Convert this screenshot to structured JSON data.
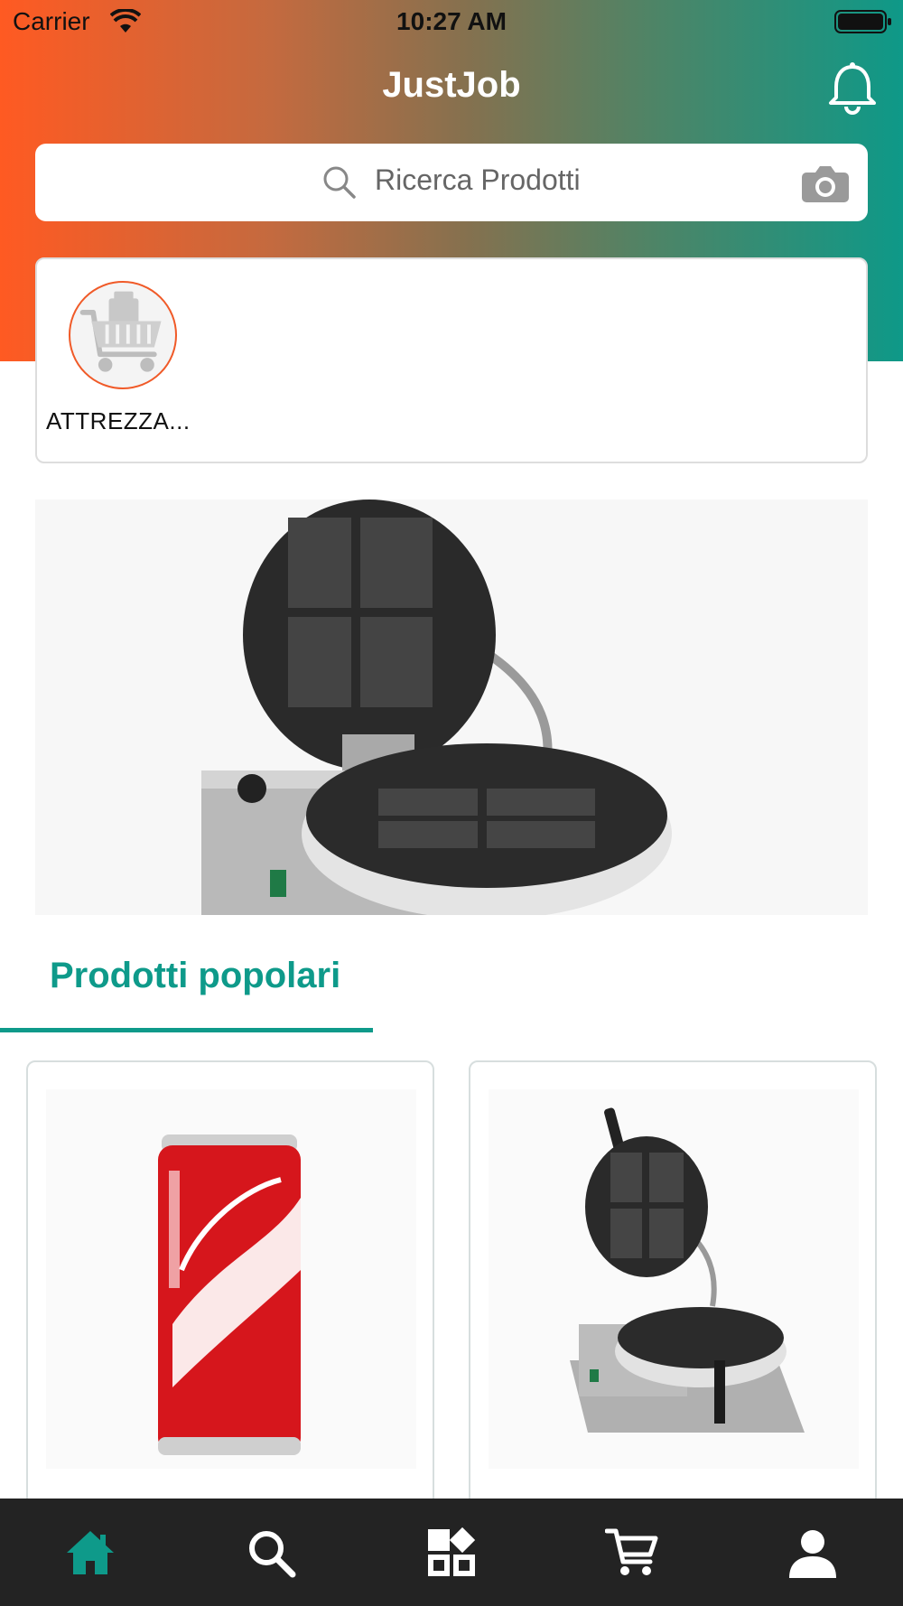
{
  "status_bar": {
    "carrier": "Carrier",
    "time": "10:27 AM"
  },
  "header": {
    "title": "JustJob"
  },
  "search": {
    "placeholder": "Ricerca Prodotti"
  },
  "categories": [
    {
      "label": "ATTREZZA..."
    }
  ],
  "section": {
    "title": "Prodotti popolari"
  },
  "products": [
    {
      "name": "coca-cola-can"
    },
    {
      "name": "waffle-maker"
    }
  ],
  "tabbar": {
    "items": [
      "home-icon",
      "search-icon",
      "categories-icon",
      "cart-icon",
      "profile-icon"
    ],
    "active_index": 0
  },
  "colors": {
    "accent": "#0e9a8a",
    "brand_orange": "#ff5a22",
    "tabbar": "#232323"
  }
}
